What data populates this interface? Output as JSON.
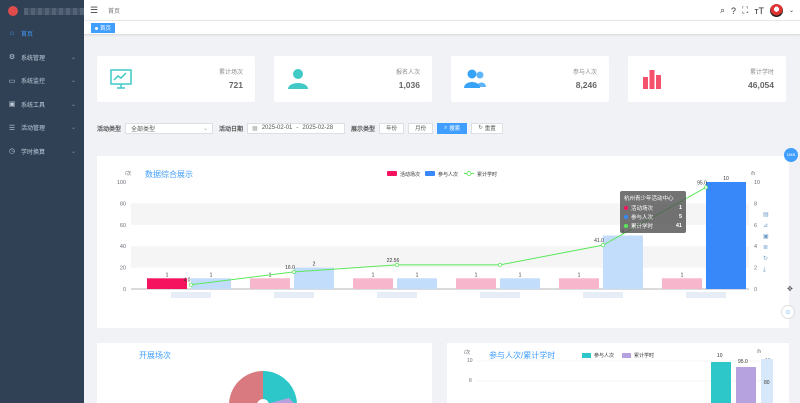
{
  "sidebar": {
    "items": [
      {
        "label": "首页",
        "icon": "home-icon",
        "active": true
      },
      {
        "label": "系统管理",
        "icon": "gear-icon"
      },
      {
        "label": "系统监控",
        "icon": "monitor-icon"
      },
      {
        "label": "系统工具",
        "icon": "tools-icon"
      },
      {
        "label": "活动管理",
        "icon": "activity-icon"
      },
      {
        "label": "学时换算",
        "icon": "hours-icon"
      }
    ]
  },
  "header": {
    "breadcrumb": "首页"
  },
  "tags": {
    "home": "首页"
  },
  "stats": [
    {
      "label": "累计场次",
      "value": "721",
      "color": "#36a3f7"
    },
    {
      "label": "报名人次",
      "value": "1,036",
      "color": "#40c9c6"
    },
    {
      "label": "参与人次",
      "value": "8,246",
      "color": "#36a3f7"
    },
    {
      "label": "累计学时",
      "value": "46,054",
      "color": "#f4516c"
    }
  ],
  "filter": {
    "type_label": "活动类型",
    "type_value": "全部类型",
    "date_label": "活动日期",
    "date_start": "2025-02-01",
    "date_sep": "-",
    "date_end": "2025-02-28",
    "display_label": "展示类型",
    "btn_year": "年份",
    "btn_month": "月份",
    "btn_search": "搜索",
    "btn_reset": "重置"
  },
  "chart_data": {
    "type": "bar",
    "title": "数据综合展示",
    "left_unit": "/次",
    "right_unit": "/h",
    "ylim_left": [
      0,
      100
    ],
    "ylim_right": [
      0,
      10
    ],
    "left_ticks": [
      "100",
      "80",
      "60",
      "40",
      "20",
      "0"
    ],
    "right_ticks": [
      "10",
      "8",
      "6",
      "4",
      "2",
      "0"
    ],
    "legend": [
      "活动场次",
      "参与人次",
      "累计学时"
    ],
    "series": [
      {
        "name": "活动场次",
        "values": [
          1,
          1,
          1,
          1,
          1,
          1
        ]
      },
      {
        "name": "参与人次",
        "values": [
          1,
          2,
          1,
          1,
          5,
          10
        ]
      },
      {
        "name": "累计学时",
        "values": [
          4.0,
          16.0,
          22.56,
          22.56,
          41.0,
          95.0
        ]
      }
    ],
    "point_labels": [
      "4.0",
      "16.0",
      "22.56",
      "41.0",
      "95.0"
    ],
    "colors": {
      "activity": "#f5135f",
      "participants": "#3888fa",
      "hours": "#5ae85a"
    }
  },
  "tooltip": {
    "title": "杭州青少年活动中心",
    "rows": [
      {
        "label": "活动场次",
        "value": "1",
        "color": "#f5135f"
      },
      {
        "label": "参与人次",
        "value": "5",
        "color": "#3888fa"
      },
      {
        "label": "累计学时",
        "value": "41",
        "color": "#5ae85a"
      }
    ]
  },
  "pie_panel": {
    "title": "开展场次"
  },
  "bar2_panel": {
    "title": "参与人次/累计学时",
    "legend": [
      "参与人次",
      "累计学时"
    ],
    "left_unit": "/次",
    "right_unit": "/h",
    "tick_top": "10",
    "tick_bottom": "8",
    "tick_right": "10",
    "tick_right2": "80",
    "labels": [
      "10",
      "95.0"
    ]
  },
  "float_badge": "18KB"
}
